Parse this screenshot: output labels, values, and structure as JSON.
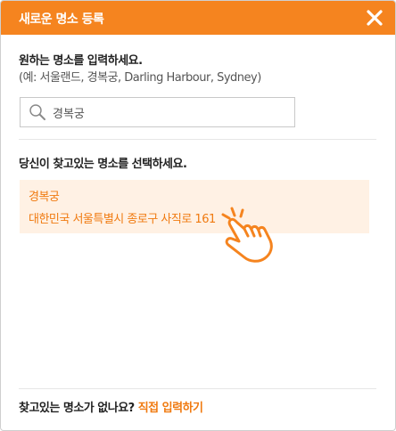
{
  "header": {
    "title": "새로운 명소 등록",
    "close_icon": "close-icon"
  },
  "prompt": {
    "title": "원하는 명소를 입력하세요.",
    "example": "(예: 서울랜드, 경복궁, Darling Harbour, Sydney)"
  },
  "search": {
    "icon": "search-icon",
    "value": "경복궁"
  },
  "results": {
    "title": "당신이 찾고있는 명소를 선택하세요.",
    "items": [
      {
        "name": "경복궁",
        "address": "대한민국 서울특별시 종로구 사직로 161"
      }
    ]
  },
  "footer": {
    "question": "찾고있는 명소가 없나요?",
    "link": "직접 입력하기"
  },
  "colors": {
    "accent": "#f5841f",
    "accent_text": "#f07a10",
    "selected_bg": "#fff1e4"
  }
}
